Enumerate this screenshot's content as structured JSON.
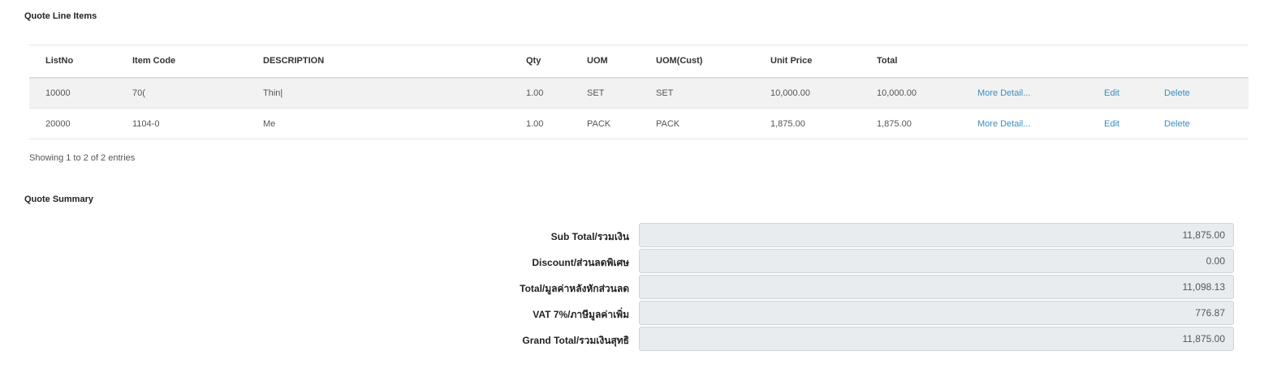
{
  "line_items": {
    "title": "Quote Line Items",
    "columns": [
      "ListNo",
      "Item Code",
      "DESCRIPTION",
      "Qty",
      "UOM",
      "UOM(Cust)",
      "Unit Price",
      "Total",
      "",
      "",
      ""
    ],
    "rows": [
      {
        "list_no": "10000",
        "item_code": "70(",
        "description": "Thin|",
        "qty": "1.00",
        "uom": "SET",
        "uom_cust": "SET",
        "unit_price": "10,000.00",
        "total": "10,000.00",
        "more": "More Detail...",
        "edit": "Edit",
        "delete": "Delete"
      },
      {
        "list_no": "20000",
        "item_code": "1104-0",
        "description": "Me",
        "qty": "1.00",
        "uom": "PACK",
        "uom_cust": "PACK",
        "unit_price": "1,875.00",
        "total": "1,875.00",
        "more": "More Detail...",
        "edit": "Edit",
        "delete": "Delete"
      }
    ],
    "info": "Showing 1 to 2 of 2 entries"
  },
  "summary": {
    "title": "Quote Summary",
    "rows": [
      {
        "label": "Sub Total/รวมเงิน",
        "value": "11,875.00"
      },
      {
        "label": "Discount/ส่วนลดพิเศษ",
        "value": "0.00"
      },
      {
        "label": "Total/มูลค่าหลังหักส่วนลด",
        "value": "11,098.13"
      },
      {
        "label": "VAT 7%/ภาษีมูลค่าเพิ่ม",
        "value": "776.87"
      },
      {
        "label": "Grand Total/รวมเงินสุทธิ",
        "value": "11,875.00"
      }
    ]
  }
}
